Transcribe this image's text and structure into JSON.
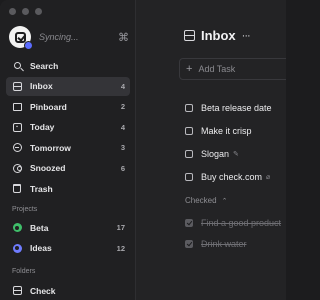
{
  "account": {
    "sync_status": "Syncing...",
    "shortcut_icon": "command-icon"
  },
  "nav": [
    {
      "label": "Search",
      "icon": "search-icon",
      "count": ""
    },
    {
      "label": "Inbox",
      "icon": "inbox-icon",
      "count": "4",
      "active": true
    },
    {
      "label": "Pinboard",
      "icon": "pinboard-icon",
      "count": "2"
    },
    {
      "label": "Today",
      "icon": "calendar-today-icon",
      "count": "4"
    },
    {
      "label": "Tomorrow",
      "icon": "tomorrow-icon",
      "count": "3"
    },
    {
      "label": "Snoozed",
      "icon": "snoozed-icon",
      "count": "6"
    },
    {
      "label": "Trash",
      "icon": "trash-icon",
      "count": ""
    }
  ],
  "projects": {
    "heading": "Projects",
    "items": [
      {
        "label": "Beta",
        "count": "17",
        "color": "#3fbf6a"
      },
      {
        "label": "Ideas",
        "count": "12",
        "color": "#6f7cff"
      }
    ]
  },
  "folders": {
    "heading": "Folders",
    "items": [
      {
        "label": "Check"
      }
    ]
  },
  "main": {
    "title": "Inbox",
    "add_task_placeholder": "Add Task",
    "tasks": [
      {
        "label": "Beta release date",
        "note_icon": ""
      },
      {
        "label": "Make it crisp",
        "note_icon": ""
      },
      {
        "label": "Slogan",
        "note_icon": "pencil-icon"
      },
      {
        "label": "Buy check.com",
        "note_icon": "attachment-icon"
      }
    ],
    "checked_heading": "Checked",
    "checked_tasks": [
      {
        "label": "Find a good product"
      },
      {
        "label": "Drink water"
      }
    ]
  },
  "colors": {
    "accent": "#5b6cff",
    "beta": "#3fbf6a",
    "ideas": "#6f7cff"
  }
}
